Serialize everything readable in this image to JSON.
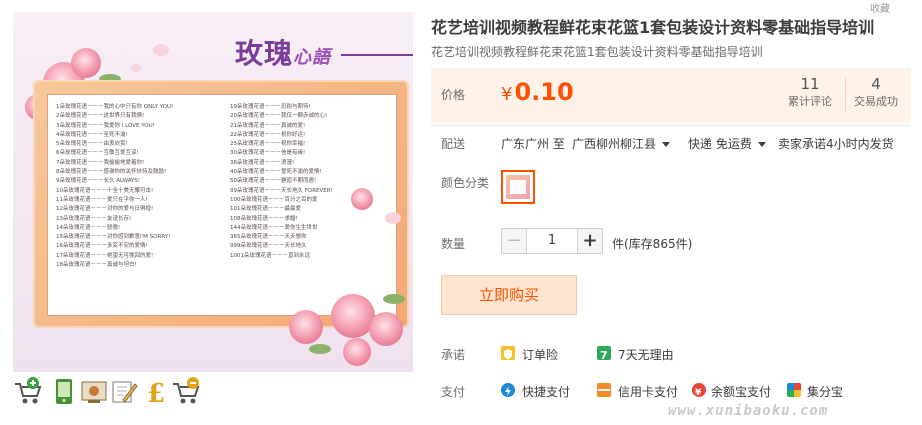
{
  "product": {
    "title": "花艺培训视频教程鲜花束花篮1套包装设计资料零基础指导培训",
    "subtitle": "花艺培训视频教程鲜花束花篮1套包装设计资料零基础指导培训",
    "image_heading": "玫瑰心語",
    "image_heading_main": "玫瑰",
    "image_heading_script": "心語",
    "image_left_lines": [
      "1朵玫瑰花语－－－我的心中只有你 ONLY YOU!",
      "2朵玫瑰花语－－－这世界只有我俩!",
      "3朵玫瑰花语－－－我爱你 I LOVE YOU!",
      "4朵玫瑰花语－－－至死不渝!",
      "5朵玫瑰花语－－－由衷欣赏!",
      "6朵玫瑰花语－－－互敬互爱互谅!",
      "7朵玫瑰花语－－－我偷偷地爱着你!",
      "8朵玫瑰花语－－－感谢你的关怀扶持及鼓励!",
      "9朵玫瑰花语－－－长久 ALWAYS!",
      "10朵玫瑰花语－－－十全十美无懈可击!",
      "11朵玫瑰花语－－－爱只在乎你一人!",
      "12朵玫瑰花语－－－对你的爱与日俱增!",
      "13朵玫瑰花语－－－友谊长存!",
      "14朵玫瑰花语－－－骄傲!",
      "15朵玫瑰花语－－－对你感到歉意I'M SORRY!",
      "16朵玫瑰花语－－－多变不安的爱情!",
      "17朵玫瑰花语－－－绝望无可挽回的爱!",
      "18朵玫瑰花语－－－真诚与坦白!"
    ],
    "image_right_lines": [
      "19朵玫瑰花语－－－忍耐与期待!",
      "20朵玫瑰花语－－－我仅一颗赤诚的心!",
      "21朵玫瑰花语－－－真诚的爱!",
      "22朵玫瑰花语－－－祝你好运!",
      "25朵玫瑰花语－－－祝你幸福!",
      "30朵玫瑰花语－－－信是有缘!",
      "36朵玫瑰花语－－－浪漫!",
      "40朵玫瑰花语－－－誓死不渝的爱情!",
      "50朵玫瑰花语－－－邂逅不期而遇!",
      "99朵玫瑰花语－－－天长地久 FOREVER!",
      "100朵玫瑰花语－－－百分之百的爱",
      "101朵玫瑰花语－－－最最爱",
      "108朵玫瑰花语－－－求婚!",
      "144朵玫瑰花语－－－爱你生生世世",
      "365朵玫瑰花语－－－天天想你",
      "999朵玫瑰花语－－－天长地久",
      "1001朵玫瑰花语－－－直到永远"
    ],
    "thumbnail_icons": [
      "add-to-cart-icon",
      "phone-icon",
      "certificate-icon",
      "edit-icon",
      "pound-currency-icon",
      "cart-discount-icon"
    ]
  },
  "price": {
    "label": "价格",
    "currency": "¥",
    "amount": "0.10",
    "color": "#ff5000"
  },
  "stats": [
    {
      "value": "11",
      "label": "累计评论"
    },
    {
      "value": "4",
      "label": "交易成功"
    }
  ],
  "shipping": {
    "label": "配送",
    "origin": "广东广州 至",
    "destination": "广西柳州柳江县",
    "method": "快递 免运费",
    "promise": "卖家承诺4小时内发货"
  },
  "color_option": {
    "label": "颜色分类"
  },
  "quantity": {
    "label": "数量",
    "value": "1",
    "minus": "−",
    "plus": "+",
    "stock": "件(库存865件)"
  },
  "buy_button": {
    "label": "立即购买"
  },
  "promise": {
    "label": "承诺",
    "items": [
      {
        "icon": "insurance-icon",
        "text": "订单险"
      },
      {
        "icon": "seven-day-return-icon",
        "text": "7天无理由"
      }
    ]
  },
  "payment": {
    "label": "支付",
    "items": [
      {
        "icon": "quick-pay-icon",
        "text": "快捷支付"
      },
      {
        "icon": "credit-card-icon",
        "text": "信用卡支付"
      },
      {
        "icon": "yuebao-icon",
        "text": "余额宝支付"
      },
      {
        "icon": "jifenbao-icon",
        "text": "集分宝"
      }
    ]
  },
  "top_right_label": "收藏",
  "watermark": "www.xunibaoku.com"
}
